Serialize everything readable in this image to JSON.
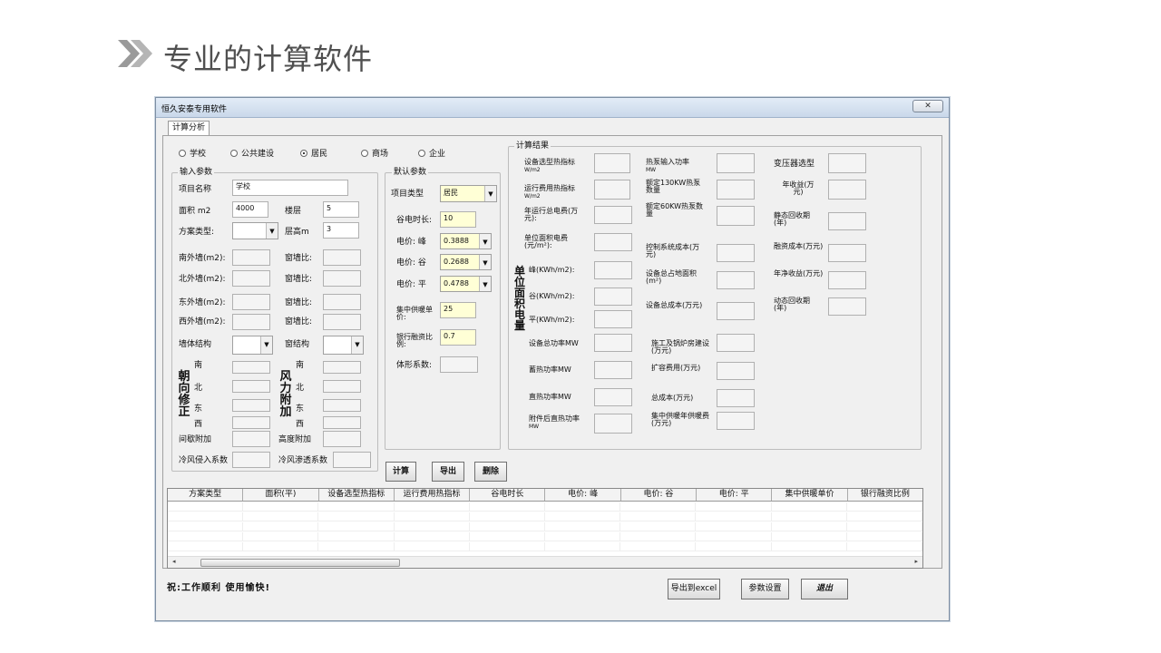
{
  "page_title": "专业的计算软件",
  "window": {
    "title": "恒久安泰专用软件",
    "close": "✕"
  },
  "tab": "计算分析",
  "radios": [
    {
      "label": "学校",
      "checked": false
    },
    {
      "label": "公共建设",
      "checked": false
    },
    {
      "label": "居民",
      "checked": true
    },
    {
      "label": "商场",
      "checked": false
    },
    {
      "label": "企业",
      "checked": false
    }
  ],
  "input": {
    "title": "输入参数",
    "project_name_label": "项目名称",
    "project_name": "学校",
    "area_label": "面积 m2",
    "area": "4000",
    "floors_label": "楼层",
    "floors": "5",
    "scheme_label": "方案类型:",
    "height_label": "层高m",
    "height": "3",
    "south_wall": "南外墙(m2):",
    "north_wall": "北外墙(m2):",
    "east_wall": "东外墙(m2):",
    "west_wall": "西外墙(m2):",
    "win_ratio": "窗墙比:",
    "wall_struct": "墙体结构",
    "win_struct": "窗结构",
    "orient_title": "朝向修正",
    "wind_title": "风力附加",
    "dir_s": "南",
    "dir_n": "北",
    "dir_e": "东",
    "dir_w": "西",
    "intermittent": "间歇附加",
    "altitude": "高度附加",
    "cold_infil": "冷风侵入系数",
    "cold_pen": "冷风渗透系数"
  },
  "defaults": {
    "title": "默认参数",
    "type_label": "项目类型",
    "type_value": "居民",
    "valley_hours_label": "谷电时长:",
    "valley_hours": "10",
    "price_peak_label": "电价: 峰",
    "price_peak": "0.3888",
    "price_valley_label": "电价: 谷",
    "price_valley": "0.2688",
    "price_flat_label": "电价: 平",
    "price_flat": "0.4788",
    "central_label": "集中供暖单价:",
    "central": "25",
    "bank_label": "银行融资比例:",
    "bank": "0.7",
    "shape_label": "体形系数:"
  },
  "results": {
    "title": "计算结果",
    "c1": {
      "design_index": "设备选型热指标",
      "design_unit": "W/m2",
      "oper_index": "运行费用热指标",
      "oper_unit": "W/m2",
      "annual_fee": "年运行总电费(万元):",
      "unit_fee": "单位面积电费(元/m²):",
      "side": "单位面积电量",
      "peak": "峰(KWh/m2):",
      "valley": "谷(KWh/m2):",
      "flat": "平(KWh/m2):",
      "total_power": "设备总功率MW",
      "storage": "蓄热功率MW",
      "direct": "直热功率MW",
      "after": "附件后直热功率",
      "after_unit": "MW"
    },
    "c2": {
      "hp_input": "热泵输入功率",
      "hp_unit": "MW",
      "rated130": "额定130KW热泵数量",
      "rated60": "额定60KW热泵数量",
      "control": "控制系统成本(万元)",
      "floor_area": "设备总占地面积(m²)",
      "equip_cost": "设备总成本(万元)",
      "boiler": "施工及锅炉房建设(万元)",
      "expand": "扩容费用(万元)",
      "total": "总成本(万元)",
      "central_annual": "集中供暖年供暖费(万元)"
    },
    "c3": {
      "transformer": "变压器选型",
      "income": "年收益(万元)",
      "static": "静态回收期(年)",
      "fin_cost": "融资成本(万元)",
      "net_income": "年净收益(万元)",
      "dynamic": "动态回收期(年)"
    }
  },
  "buttons": {
    "calc": "计算",
    "export": "导出",
    "delete": "删除",
    "excel": "导出到excel",
    "settings": "参数设置",
    "exit": "退出"
  },
  "table_headers": [
    "方案类型",
    "面积(平)",
    "设备选型热指标",
    "运行费用热指标",
    "谷电时长",
    "电价: 峰",
    "电价: 谷",
    "电价: 平",
    "集中供暖单价",
    "银行融资比例"
  ],
  "footer": "祝:工作顺利 使用愉快!"
}
